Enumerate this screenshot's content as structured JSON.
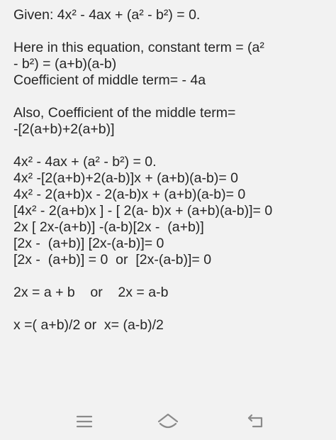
{
  "document": {
    "lines": [
      "Given: 4x² - 4ax + (a² - b²) = 0.",
      "",
      "Here in this equation, constant term = (a²",
      "- b²) = (a+b)(a-b)",
      "Coefficient of middle term= - 4a",
      "",
      "Also, Coefficient of the middle term=",
      "-[2(a+b)+2(a+b)]",
      "",
      "4x² - 4ax + (a² - b²) = 0.",
      "4x² -[2(a+b)+2(a-b)]x + (a+b)(a-b)= 0",
      "4x² - 2(a+b)x - 2(a-b)x + (a+b)(a-b)= 0",
      "[4x² - 2(a+b)x ] - [ 2(a- b)x + (a+b)(a-b)]= 0",
      "2x [ 2x-(a+b)] -(a-b)[2x -  (a+b)]",
      "[2x -  (a+b)] [2x-(a-b)]= 0",
      "[2x -  (a+b)] = 0  or  [2x-(a-b)]= 0",
      "",
      "2x = a + b    or    2x = a-b",
      "",
      "x =( a+b)/2 or  x= (a-b)/2"
    ]
  },
  "navbar": {
    "icons": [
      "menu-icon",
      "home-icon",
      "back-icon"
    ],
    "color": "#8a8a8a"
  }
}
